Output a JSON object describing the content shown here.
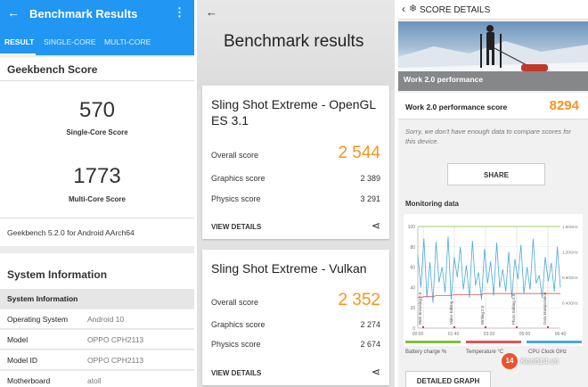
{
  "geekbench": {
    "title": "Benchmark Results",
    "tabs": [
      "RESULT",
      "SINGLE-CORE",
      "MULTI-CORE"
    ],
    "score_heading": "Geekbench Score",
    "single_value": "570",
    "single_label": "Single-Core Score",
    "multi_value": "1773",
    "multi_label": "Multi-Core Score",
    "version": "Geekbench 5.2.0 for Android AArch64",
    "sysinfo_heading": "System Information",
    "sysinfo_sub": "System Information",
    "rows": [
      {
        "k": "Operating System",
        "v": "Android 10"
      },
      {
        "k": "Model",
        "v": "OPPO CPH2113"
      },
      {
        "k": "Model ID",
        "v": "OPPO CPH2113"
      },
      {
        "k": "Motherboard",
        "v": "atoll"
      }
    ]
  },
  "threedmark": {
    "title": "Benchmark results",
    "cards": [
      {
        "name": "Sling Shot Extreme - OpenGL ES 3.1",
        "overall_label": "Overall score",
        "overall": "2 544",
        "graphics_label": "Graphics score",
        "graphics": "2 389",
        "physics_label": "Physics score",
        "physics": "3 291",
        "view": "VIEW DETAILS"
      },
      {
        "name": "Sling Shot Extreme - Vulkan",
        "overall_label": "Overall score",
        "overall": "2 352",
        "graphics_label": "Graphics score",
        "graphics": "2 274",
        "physics_label": "Physics score",
        "physics": "2 674",
        "view": "VIEW DETAILS"
      }
    ]
  },
  "pcmark": {
    "title": "SCORE DETAILS",
    "hero_label": "Work 2.0 performance",
    "score_label": "Work 2.0 performance score",
    "score": "8294",
    "message": "Sorry, we don't have enough data to compare scores for this device.",
    "share": "SHARE",
    "monitoring": "Monitoring data",
    "legend": [
      "Battery charge %",
      "Temperature °C",
      "CPU Clock GHz"
    ],
    "detailed": "DETAILED GRAPH",
    "watermark": "Kenh14.vn",
    "watermark_badge": "14"
  },
  "chart_data": {
    "type": "line",
    "x_ticks": [
      "00:00",
      "01:40",
      "03:20",
      "05:00",
      "06:40"
    ],
    "y_ticks": [
      0,
      20,
      40,
      60,
      80,
      100
    ],
    "y2_ticks": [
      "0.40GHz",
      "0.80GHz",
      "1.20GHz",
      "1.60GHz"
    ],
    "ylim": [
      0,
      100
    ],
    "phase_labels": [
      "Web Browsing 2.0",
      "Video Editing",
      "Writing 2.0",
      "Photo Editing 2.0",
      "Data Manipulation"
    ],
    "series": [
      {
        "name": "CPU Clock GHz",
        "values": [
          72,
          40,
          88,
          30,
          65,
          25,
          85,
          45,
          60,
          35,
          90,
          28,
          70,
          50,
          80,
          38,
          62,
          30,
          86,
          42,
          55,
          28,
          78,
          44,
          66,
          32,
          84,
          40,
          58,
          36,
          75,
          30,
          68,
          48,
          82,
          34,
          60,
          38,
          88,
          44,
          52,
          30,
          70,
          46,
          64,
          36,
          80,
          40
        ]
      },
      {
        "name": "Battery charge %",
        "values": [
          100,
          100,
          100,
          100,
          100,
          100,
          100,
          100,
          100,
          100,
          100,
          100,
          100,
          100,
          100,
          100,
          100,
          100,
          100,
          100,
          100,
          100,
          100,
          100,
          100,
          100,
          100,
          100,
          100,
          100,
          100,
          100,
          100,
          100,
          100,
          100,
          100,
          100,
          100,
          100,
          100,
          100,
          100,
          100,
          100,
          100,
          100,
          100
        ]
      },
      {
        "name": "Temperature °C",
        "values": [
          30,
          30,
          31,
          31,
          31,
          31,
          32,
          32,
          32,
          32,
          32,
          32,
          33,
          33,
          33,
          33,
          33,
          33,
          33,
          33,
          33,
          33,
          34,
          34,
          34,
          34,
          34,
          34,
          34,
          34,
          34,
          34,
          34,
          34,
          34,
          34,
          34,
          34,
          34,
          34,
          34,
          34,
          34,
          34,
          34,
          34,
          34,
          34
        ]
      }
    ],
    "colors": {
      "cpu": "#4aa8d8",
      "battery": "#7fbf3f",
      "temperature": "#e25555"
    }
  }
}
